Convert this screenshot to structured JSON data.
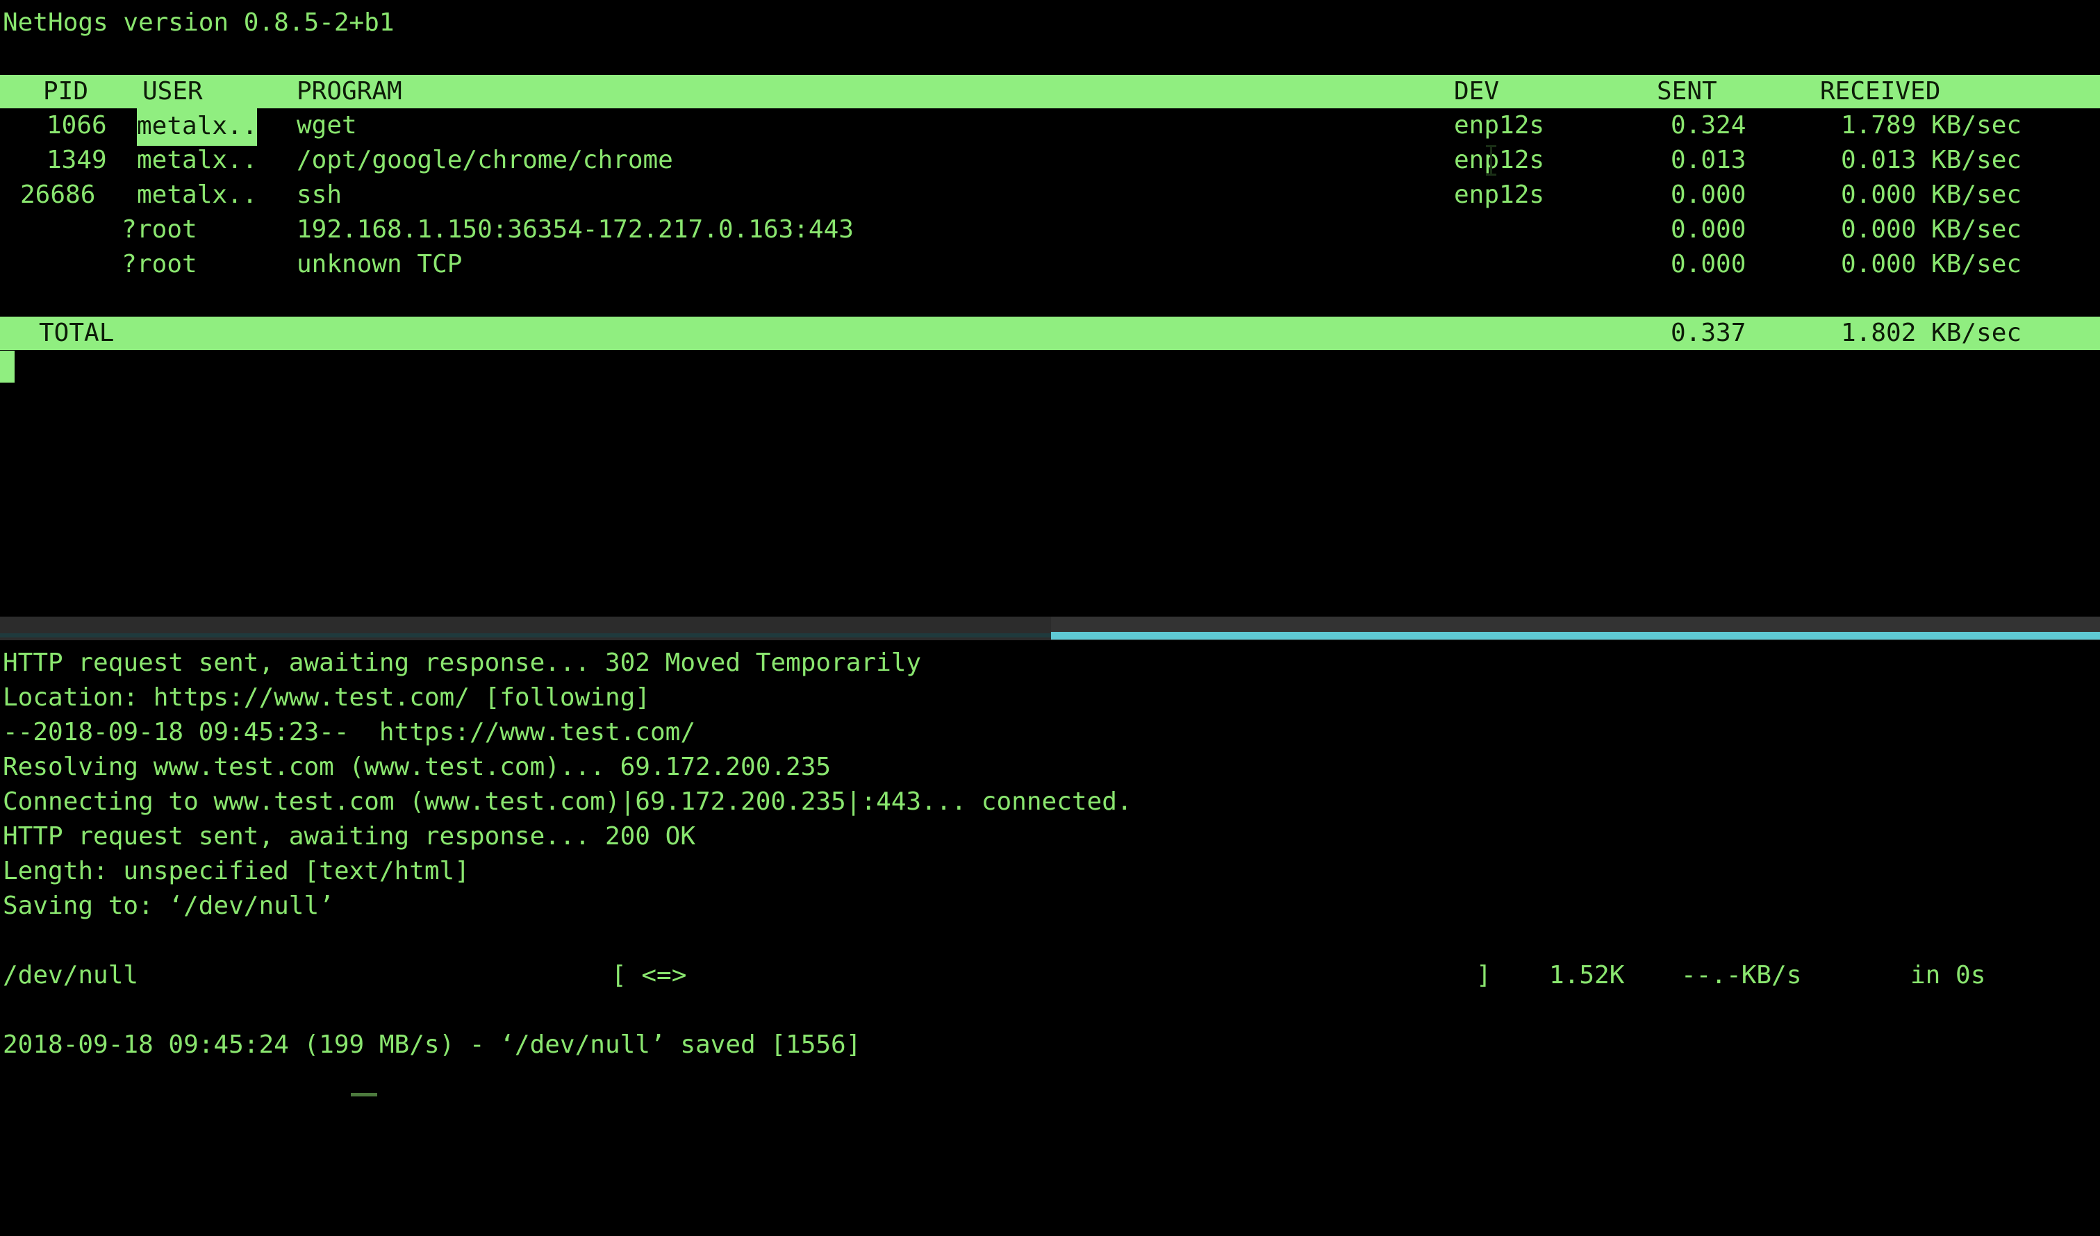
{
  "app": {
    "name": "nethogs",
    "version_line": "NetHogs version 0.8.5-2+b1"
  },
  "nethogs": {
    "columns": {
      "pid": "PID",
      "user": "USER",
      "program": "PROGRAM",
      "dev": "DEV",
      "sent": "SENT",
      "received": "RECEIVED"
    },
    "rows": [
      {
        "pid": "1066",
        "user": "metalx..",
        "user_selected": true,
        "program": "wget",
        "dev": "enp12s",
        "sent": "0.324",
        "received": "1.789 KB/sec"
      },
      {
        "pid": "1349",
        "user": "metalx..",
        "user_selected": false,
        "program": "/opt/google/chrome/chrome",
        "dev": "enp12s",
        "sent": "0.013",
        "received": "0.013 KB/sec"
      },
      {
        "pid": "26686",
        "user": "metalx..",
        "user_selected": false,
        "program": "ssh",
        "dev": "enp12s",
        "sent": "0.000",
        "received": "0.000 KB/sec"
      },
      {
        "pid": "?",
        "user": "root",
        "user_selected": false,
        "program": "192.168.1.150:36354-172.217.0.163:443",
        "dev": "",
        "sent": "0.000",
        "received": "0.000 KB/sec"
      },
      {
        "pid": "?",
        "user": "root",
        "user_selected": false,
        "program": "unknown TCP",
        "dev": "",
        "sent": "0.000",
        "received": "0.000 KB/sec"
      }
    ],
    "total": {
      "label": "TOTAL",
      "sent": "0.337",
      "received": "1.802 KB/sec"
    }
  },
  "wget_log": {
    "lines": [
      "HTTP request sent, awaiting response... 302 Moved Temporarily",
      "Location: https://www.test.com/ [following]",
      "--2018-09-18 09:45:23--  https://www.test.com/",
      "Resolving www.test.com (www.test.com)... 69.172.200.235",
      "Connecting to www.test.com (www.test.com)|69.172.200.235|:443... connected.",
      "HTTP request sent, awaiting response... 200 OK",
      "Length: unspecified [text/html]",
      "Saving to: ‘/dev/null’"
    ],
    "progress": {
      "filename": "/dev/null",
      "bar_open": "[ <=>",
      "bar_close": "]",
      "size": "1.52K",
      "rate": "--.-KB/s",
      "elapsed": "in 0s"
    },
    "saved_line": "2018-09-18 09:45:24 (199 MB/s) - ‘/dev/null’ saved [1556]"
  },
  "colors": {
    "background": "#000000",
    "foreground": "#8ae66f",
    "highlight_bg": "#90ee80",
    "highlight_fg": "#0d1c08",
    "divider_bg": "#333333",
    "divider_accent": "#5fc9d4"
  }
}
